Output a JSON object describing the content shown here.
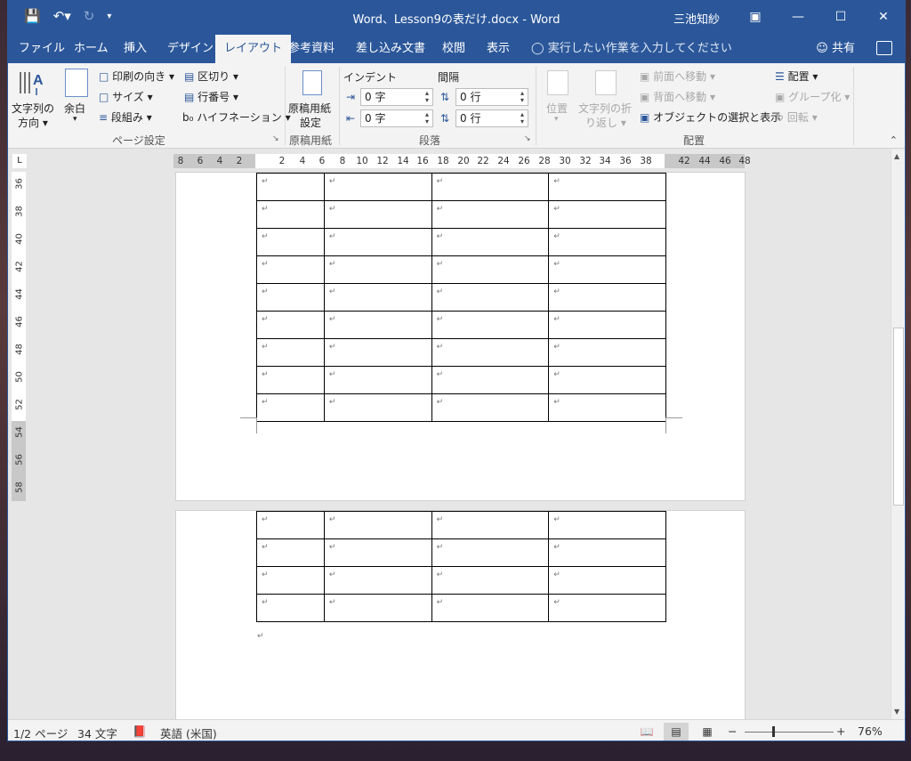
{
  "window": {
    "title": "Word、Lesson9の表だけ.docx  -  Word",
    "user": "三池知紗",
    "qat": {
      "save_icon": "floppy-disk-icon",
      "undo_icon": "undo-icon",
      "redo_icon": "redo-icon",
      "customize_icon": "customize-qat-icon"
    }
  },
  "tabs": [
    {
      "label": "ファイル",
      "active": false
    },
    {
      "label": "ホーム",
      "active": false
    },
    {
      "label": "挿入",
      "active": false
    },
    {
      "label": "デザイン",
      "active": false
    },
    {
      "label": "レイアウト",
      "active": true
    },
    {
      "label": "参考資料",
      "active": false
    },
    {
      "label": "差し込み文書",
      "active": false
    },
    {
      "label": "校閲",
      "active": false
    },
    {
      "label": "表示",
      "active": false
    }
  ],
  "tell_me": "実行したい作業を入力してください",
  "share": "共有",
  "ribbon": {
    "page_setup": {
      "text_direction_1": "文字列の",
      "text_direction_2": "方向 ▾",
      "margins_1": "余白",
      "margins_2": "▾",
      "orientation": "印刷の向き ▾",
      "size": "サイズ ▾",
      "columns": "段組み ▾",
      "breaks": "区切り ▾",
      "line_numbers": "行番号 ▾",
      "hyphenation": "ハイフネーション ▾",
      "group": "ページ設定"
    },
    "genko": {
      "label_1": "原稿用紙",
      "label_2": "設定",
      "group": "原稿用紙"
    },
    "paragraph": {
      "indent_header": "インデント",
      "spacing_header": "間隔",
      "indent_left": "0 字",
      "indent_right": "0 字",
      "spacing_before": "0 行",
      "spacing_after": "0 行",
      "group": "段落"
    },
    "arrange": {
      "position_1": "位置",
      "position_2": "▾",
      "wrap_1": "文字列の折",
      "wrap_2": "り返し ▾",
      "bring_forward": "前面へ移動  ▾",
      "send_backward": "背面へ移動  ▾",
      "selection_pane": "オブジェクトの選択と表示",
      "align": "配置 ▾",
      "group_objects": "グループ化 ▾",
      "rotate": "回転 ▾",
      "group": "配置"
    }
  },
  "ruler": {
    "h_ticks": [
      "8",
      "6",
      "4",
      "2",
      "2",
      "4",
      "6",
      "8",
      "10",
      "12",
      "14",
      "16",
      "18",
      "20",
      "22",
      "24",
      "26",
      "28",
      "30",
      "32",
      "34",
      "36",
      "38",
      "42",
      "44",
      "46",
      "48"
    ],
    "v_ticks": [
      "36",
      "38",
      "40",
      "42",
      "44",
      "46",
      "48",
      "50",
      "52",
      "54",
      "56",
      "58"
    ],
    "corner": "L"
  },
  "document": {
    "para_mark": "↵",
    "page1_rows": 9,
    "page2_rows": 4,
    "columns": 4
  },
  "status": {
    "page": "1/2 ページ",
    "words": "34 文字",
    "proof_icon": "proofing-icon",
    "language": "英語 (米国)",
    "zoom": "76%",
    "zoom_minus": "−",
    "zoom_plus": "+"
  }
}
